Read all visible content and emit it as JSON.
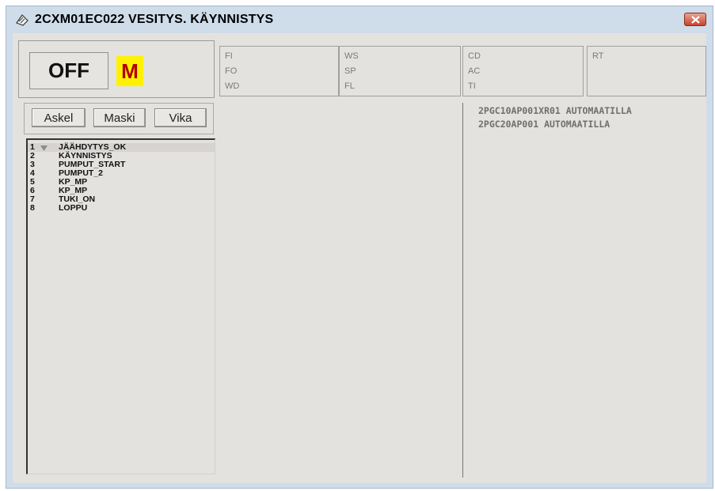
{
  "window": {
    "title": "2CXM01EC022 VESITYS. KÄYNNISTYS"
  },
  "status": {
    "mode": "OFF",
    "mode_letter": "M"
  },
  "signals": {
    "col1": [
      "FI",
      "FO",
      "WD"
    ],
    "col2": [
      "WS",
      "SP",
      "FL"
    ],
    "col3": [
      "CD",
      "AC",
      "TI"
    ],
    "col4": [
      "RT"
    ]
  },
  "buttons": {
    "askel": "Askel",
    "maski": "Maski",
    "vika": "Vika"
  },
  "steps": [
    {
      "num": "1",
      "label": "JÄÄHDYTYS_OK"
    },
    {
      "num": "2",
      "label": "KÄYNNISTYS"
    },
    {
      "num": "3",
      "label": "PUMPUT_START"
    },
    {
      "num": "4",
      "label": "PUMPUT_2"
    },
    {
      "num": "5",
      "label": "KP_MP"
    },
    {
      "num": "6",
      "label": "KP_MP"
    },
    {
      "num": "7",
      "label": "TUKI_ON"
    },
    {
      "num": "8",
      "label": "LOPPU"
    }
  ],
  "messages": [
    "2PGC10AP001XR01 AUTOMAATILLA",
    "2PGC20AP001 AUTOMAATILLA"
  ],
  "colors": {
    "mode_letter_bg": "#fff200",
    "mode_letter_fg": "#b00000",
    "client_bg": "#e4e2df",
    "frame": "#cfdcea"
  }
}
